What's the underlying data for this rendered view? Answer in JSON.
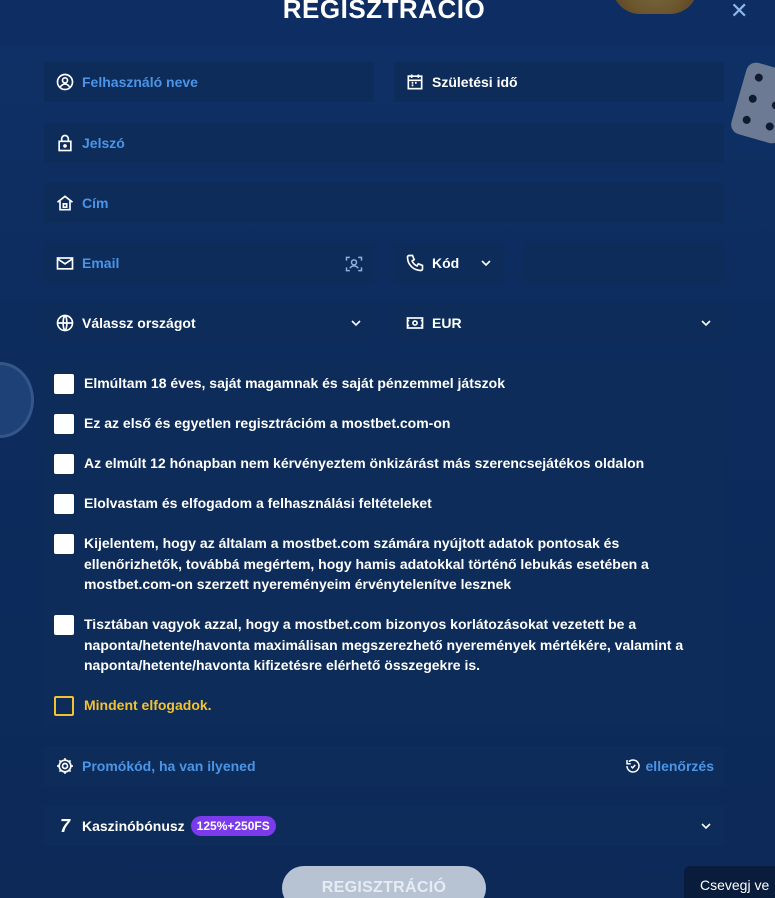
{
  "modal": {
    "title": "REGISZTRÁCIÓ",
    "close_glyph": "✕"
  },
  "form": {
    "username_placeholder": "Felhasználó neve",
    "birthdate_label": "Születési idő",
    "password_placeholder": "Jelszó",
    "address_placeholder": "Cím",
    "email_placeholder": "Email",
    "phone_code_label": "Kód",
    "phone_number_placeholder": "",
    "country_label": "Válassz országot",
    "currency_label": "EUR"
  },
  "checkboxes": [
    {
      "text": "Elmúltam 18 éves, saját magamnak és saját pénzemmel játszok",
      "checked": false
    },
    {
      "text": "Ez az első és egyetlen regisztrációm a mostbet.com-on",
      "checked": false
    },
    {
      "text": "Az elmúlt 12 hónapban nem kérvényeztem önkizárást más szerencsejátékos oldalon",
      "checked": false
    },
    {
      "text": "Elolvastam és elfogadom a felhasználási feltételeket",
      "checked": false
    },
    {
      "text": "Kijelentem, hogy az általam a mostbet.com számára nyújtott adatok pontosak és ellenőrizhetők, továbbá megértem, hogy hamis adatokkal történő lebukás esetében a mostbet.com-on szerzett nyereményeim érvénytelenítve lesznek",
      "checked": false
    },
    {
      "text": "Tisztában vagyok azzal, hogy a mostbet.com bizonyos korlátozásokat vezetett be a naponta/hetente/havonta maximálisan megszerezhető nyeremények mértékére, valamint a naponta/hetente/havonta kifizetésre elérhető összegekre is.",
      "checked": false
    }
  ],
  "accept_all": "Mindent elfogadok.",
  "promo": {
    "placeholder": "Promókód, ha van ilyened",
    "check_label": "ellenőrzés"
  },
  "bonus": {
    "label": "Kaszinóbónusz",
    "badge": "125%+250FS"
  },
  "submit_label": "REGISZTRÁCIÓ",
  "chat_label": "Csevegj ve",
  "colors": {
    "field_bg": "#0d2c59",
    "placeholder": "#4a95e8",
    "accent_yellow": "#f2c230",
    "badge_purple": "#7c3aed"
  }
}
